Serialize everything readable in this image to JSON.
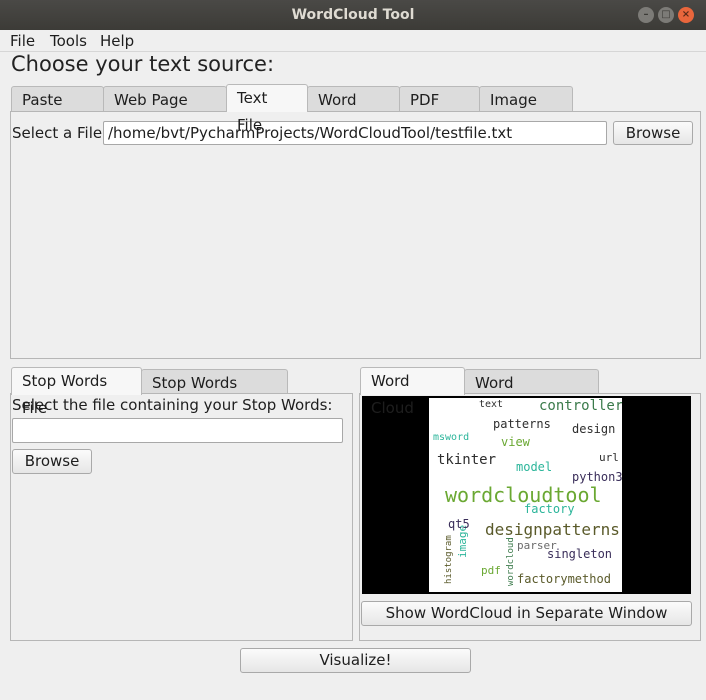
{
  "window": {
    "title": "WordCloud Tool"
  },
  "menubar": {
    "file": "File",
    "tools": "Tools",
    "help": "Help"
  },
  "heading": "Choose your text source:",
  "source_tabs": [
    "Paste Text",
    "Web Page URL",
    "Text File",
    "Word Doc",
    "PDF File",
    "Image File"
  ],
  "source_active_tab": "Text File",
  "text_file": {
    "label": "Select a File:",
    "path": "/home/bvt/PycharmProjects/WordCloudTool/testfile.txt",
    "browse_label": "Browse"
  },
  "stopwords_tabs": [
    "Stop Words File",
    "Stop Words Editor"
  ],
  "stopwords_active_tab": "Stop Words File",
  "stopwords_file": {
    "label": "Select the file containing your Stop Words:",
    "value": "",
    "browse_label": "Browse"
  },
  "output_tabs": [
    "Word Cloud",
    "Word Histogram"
  ],
  "output_active_tab": "Word Cloud",
  "wordcloud": {
    "words": [
      "wordcloudtool",
      "designpatterns",
      "controller",
      "tkinter",
      "patterns",
      "design",
      "model",
      "factory",
      "python3",
      "factorymethod",
      "singleton",
      "parser",
      "view",
      "msword",
      "image",
      "histogram",
      "url",
      "pdf",
      "qt5",
      "text",
      "wordcloud"
    ],
    "colors": {
      "green": "#6aa832",
      "teal": "#2bb59a",
      "olive": "#5a5a2a",
      "purple": "#3a2e5a",
      "dark": "#2e2e2e"
    }
  },
  "show_window_button": "Show WordCloud in Separate Window",
  "visualize_button": "Visualize!"
}
